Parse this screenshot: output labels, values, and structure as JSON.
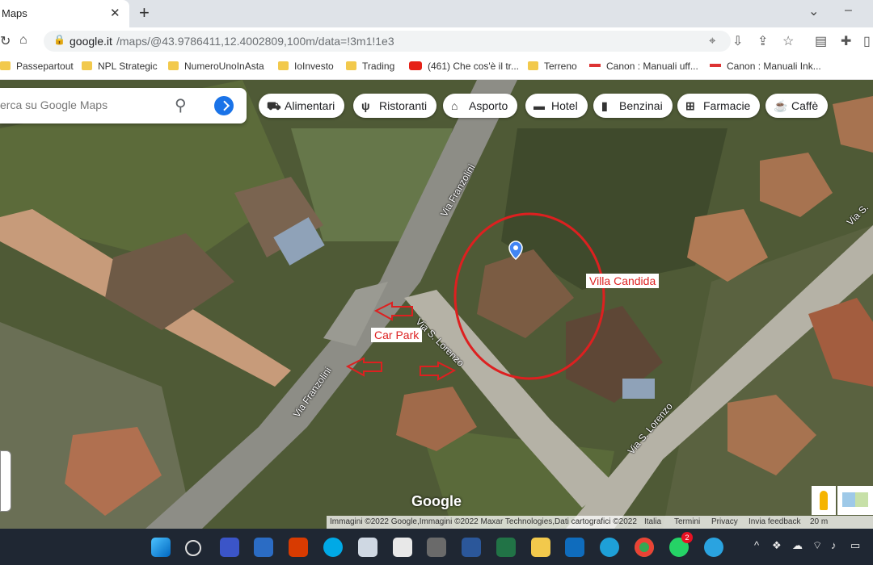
{
  "browser": {
    "tab_title": "Maps",
    "close_glyph": "✕",
    "new_tab_glyph": "+",
    "url_host": "google.it",
    "url_rest": "/maps/@43.9786411,12.4002809,100m/data=!3m1!1e3",
    "bookmarks": [
      {
        "label": "Passepartout",
        "icon": "folder-icon"
      },
      {
        "label": "NPL Strategic",
        "icon": "folder-icon"
      },
      {
        "label": "NumeroUnoInAsta",
        "icon": "folder-icon"
      },
      {
        "label": "IoInvesto",
        "icon": "folder-icon"
      },
      {
        "label": "Trading",
        "icon": "folder-icon"
      },
      {
        "label": "(461) Che cos'è il tr...",
        "icon": "youtube-icon"
      },
      {
        "label": "Terreno",
        "icon": "folder-icon"
      },
      {
        "label": "Canon : Manuali uff...",
        "icon": "canon-icon"
      },
      {
        "label": "Canon : Manuali Ink...",
        "icon": "canon-icon"
      }
    ]
  },
  "maps": {
    "search_placeholder": "erca su Google Maps",
    "chips": [
      {
        "label": "Alimentari",
        "icon": "cart-icon"
      },
      {
        "label": "Ristoranti",
        "icon": "cutlery-icon"
      },
      {
        "label": "Asporto",
        "icon": "takeout-icon"
      },
      {
        "label": "Hotel",
        "icon": "bed-icon"
      },
      {
        "label": "Benzinai",
        "icon": "fuel-icon"
      },
      {
        "label": "Farmacie",
        "icon": "pharmacy-icon"
      },
      {
        "label": "Caffè",
        "icon": "coffee-icon"
      }
    ],
    "annotations": {
      "villa": "Villa Candida",
      "car_park": "Car Park"
    },
    "roads": [
      "Via Franzolini",
      "Via S. Lorenzo",
      "Via Franzolini",
      "Via S. Lorenzo",
      "Via S."
    ],
    "logo": "Google",
    "attribution": "Immagini ©2022 Google,Immagini ©2022 Maxar Technologies,Dati cartografici ©2022",
    "footer_links": [
      "Italia",
      "Termini",
      "Privacy",
      "Invia feedback"
    ],
    "scale": "20 m"
  },
  "taskbar": {
    "whatsapp_badge": "2"
  },
  "colors": {
    "annotation": "#dd2020",
    "accent": "#1a73e8"
  }
}
